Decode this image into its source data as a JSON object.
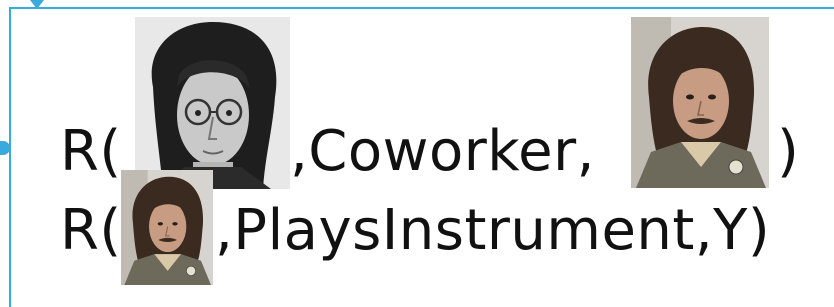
{
  "line1": {
    "prefix": "R(",
    "middle": ",Coworker,",
    "suffix": ")",
    "subject_image": "john-lennon-portrait",
    "object_image": "george-harrison-portrait"
  },
  "line2": {
    "prefix": "R(",
    "middle": ",PlaysInstrument,Y)",
    "subject_image": "george-harrison-portrait"
  },
  "colors": {
    "frame": "#3aa9dc",
    "text": "#111111"
  }
}
